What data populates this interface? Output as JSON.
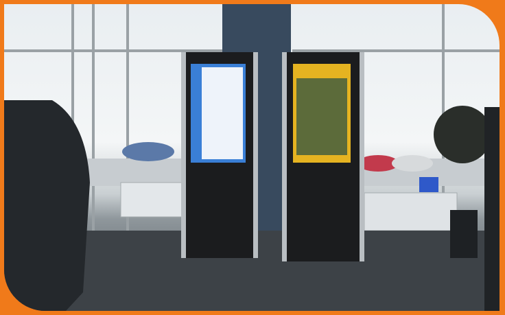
{
  "image": {
    "description_type": "photograph",
    "frame_color": "#f07a1a",
    "left_screen_color": "#3a7fd6",
    "right_screen_color": "#e5b321"
  }
}
